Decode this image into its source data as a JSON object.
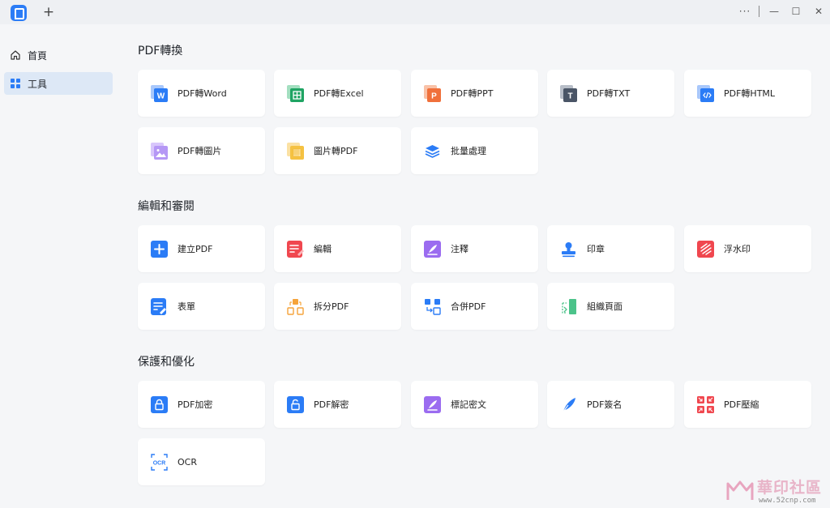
{
  "titlebar": {
    "add_tab_label": "+",
    "more_label": "···",
    "minimize_label": "—",
    "maximize_label": "☐",
    "close_label": "✕"
  },
  "sidebar": {
    "items": [
      {
        "label": "首頁",
        "icon": "home-icon",
        "active": false
      },
      {
        "label": "工具",
        "icon": "grid-icon",
        "active": true
      }
    ]
  },
  "sections": [
    {
      "title": "PDF轉換",
      "cards": [
        {
          "label": "PDF轉Word",
          "icon": "word-icon",
          "color": "#2b7cf6"
        },
        {
          "label": "PDF轉Excel",
          "icon": "excel-icon",
          "color": "#1fa463"
        },
        {
          "label": "PDF轉PPT",
          "icon": "ppt-icon",
          "color": "#f0703b"
        },
        {
          "label": "PDF轉TXT",
          "icon": "txt-icon",
          "color": "#4a5566"
        },
        {
          "label": "PDF轉HTML",
          "icon": "html-icon",
          "color": "#2b7cf6"
        },
        {
          "label": "PDF轉圖片",
          "icon": "image-icon",
          "color": "#9b6cf0"
        },
        {
          "label": "圖片轉PDF",
          "icon": "image-to-pdf-icon",
          "color": "#f0b429"
        },
        {
          "label": "批量處理",
          "icon": "layers-icon",
          "color": "#2b7cf6"
        }
      ]
    },
    {
      "title": "編輯和審閱",
      "cards": [
        {
          "label": "建立PDF",
          "icon": "plus-icon",
          "color": "#2b7cf6"
        },
        {
          "label": "編輯",
          "icon": "edit-icon",
          "color": "#f0474f"
        },
        {
          "label": "注釋",
          "icon": "annotate-icon",
          "color": "#9b6cf0"
        },
        {
          "label": "印章",
          "icon": "stamp-icon",
          "color": "#2b7cf6"
        },
        {
          "label": "浮水印",
          "icon": "watermark-icon",
          "color": "#f0474f"
        },
        {
          "label": "表單",
          "icon": "form-icon",
          "color": "#2b7cf6"
        },
        {
          "label": "拆分PDF",
          "icon": "split-icon",
          "color": "#f0a030"
        },
        {
          "label": "合併PDF",
          "icon": "merge-icon",
          "color": "#2b7cf6"
        },
        {
          "label": "組織頁面",
          "icon": "organize-icon",
          "color": "#3cb371"
        }
      ]
    },
    {
      "title": "保護和優化",
      "cards": [
        {
          "label": "PDF加密",
          "icon": "lock-icon",
          "color": "#2b7cf6"
        },
        {
          "label": "PDF解密",
          "icon": "unlock-icon",
          "color": "#2b7cf6"
        },
        {
          "label": "標記密文",
          "icon": "redact-icon",
          "color": "#9b6cf0"
        },
        {
          "label": "PDF簽名",
          "icon": "sign-icon",
          "color": "#2b7cf6"
        },
        {
          "label": "PDF壓縮",
          "icon": "compress-icon",
          "color": "#f0474f"
        },
        {
          "label": "OCR",
          "icon": "ocr-icon",
          "color": "#2b7cf6"
        }
      ]
    }
  ],
  "watermark": {
    "text": "華印社區",
    "url": "www.52cnp.com"
  }
}
